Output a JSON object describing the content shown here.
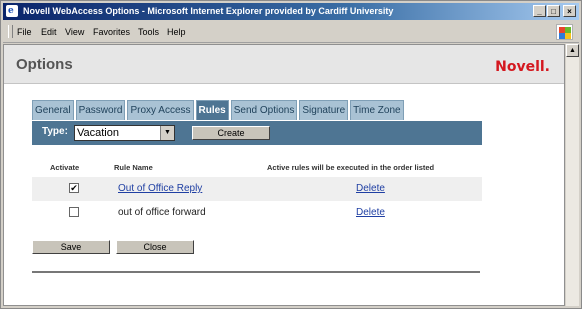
{
  "window": {
    "title": "Novell WebAccess Options - Microsoft Internet Explorer provided by Cardiff University",
    "controls": {
      "minimize": "_",
      "maximize": "□",
      "close": "×"
    }
  },
  "menu": [
    "File",
    "Edit",
    "View",
    "Favorites",
    "Tools",
    "Help"
  ],
  "header": {
    "title": "Options",
    "brand": "Novell."
  },
  "tabs": [
    {
      "label": "General",
      "active": false
    },
    {
      "label": "Password",
      "active": false
    },
    {
      "label": "Proxy Access",
      "active": false
    },
    {
      "label": "Rules",
      "active": true
    },
    {
      "label": "Send Options",
      "active": false
    },
    {
      "label": "Signature",
      "active": false
    },
    {
      "label": "Time Zone",
      "active": false
    }
  ],
  "typebar": {
    "label": "Type:",
    "selected": "Vacation",
    "create_label": "Create"
  },
  "table": {
    "headers": {
      "activate": "Activate",
      "rule_name": "Rule Name",
      "note": "Active rules will be executed in the order listed"
    },
    "rows": [
      {
        "activated": true,
        "check": "✔",
        "name": "Out of Office Reply",
        "linked": true,
        "action": "Delete"
      },
      {
        "activated": false,
        "check": "",
        "name": "out of office forward",
        "linked": false,
        "action": "Delete"
      }
    ]
  },
  "buttons": {
    "save": "Save",
    "close": "Close"
  },
  "scroll": {
    "up": "▲"
  },
  "colors": {
    "tab_bar": "#4e7593",
    "tab_inactive": "#a9c2d4",
    "brand": "#d4181f",
    "link": "#1f3fa3"
  }
}
